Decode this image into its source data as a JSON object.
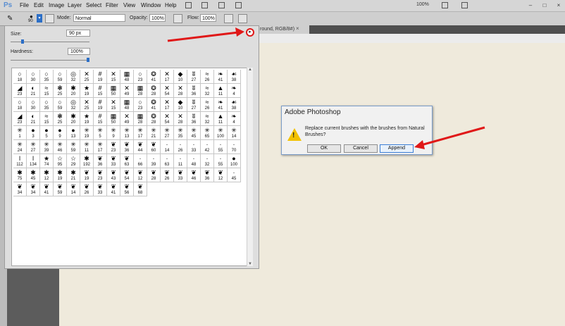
{
  "app": {
    "logo": "Ps",
    "menu": [
      "File",
      "Edit",
      "Image",
      "Layer",
      "Select",
      "Filter",
      "View",
      "Window",
      "Help"
    ],
    "zoom_display": "100%",
    "window_controls": [
      "–",
      "□",
      "×"
    ]
  },
  "options_bar": {
    "brush_size": "90",
    "mode_label": "Mode:",
    "mode_value": "Normal",
    "opacity_label": "Opacity:",
    "opacity_value": "100%",
    "flow_label": "Flow:",
    "flow_value": "100%"
  },
  "document_tab": {
    "title": "round, RGB/8#)",
    "close": "×"
  },
  "brush_panel": {
    "size_label": "Size:",
    "size_value": "90 px",
    "size_fraction": 0.15,
    "hardness_label": "Hardness:",
    "hardness_value": "100%",
    "hardness_fraction": 1.0,
    "menu_icon": "panel-flyout-menu-icon",
    "presets": [
      {
        "g": "○",
        "s": "18"
      },
      {
        "g": "○",
        "s": "30"
      },
      {
        "g": "○",
        "s": "35"
      },
      {
        "g": "○",
        "s": "59"
      },
      {
        "g": "◎",
        "s": "32"
      },
      {
        "g": "✕",
        "s": "25"
      },
      {
        "g": "#",
        "s": "19"
      },
      {
        "g": "✕",
        "s": "15"
      },
      {
        "g": "▦",
        "s": "48"
      },
      {
        "g": "○",
        "s": "23"
      },
      {
        "g": "❂",
        "s": "41"
      },
      {
        "g": "✕",
        "s": "17"
      },
      {
        "g": "◆",
        "s": "10"
      },
      {
        "g": "ʬ",
        "s": "27"
      },
      {
        "g": "≈",
        "s": "26"
      },
      {
        "g": "❧",
        "s": "41"
      },
      {
        "g": "☙",
        "s": "38"
      },
      {
        "g": "◢",
        "s": "23"
      },
      {
        "g": "◐",
        "s": "21"
      },
      {
        "g": "≈",
        "s": "15"
      },
      {
        "g": "❃",
        "s": "25"
      },
      {
        "g": "✱",
        "s": "20"
      },
      {
        "g": "★",
        "s": "19"
      },
      {
        "g": "#",
        "s": "15"
      },
      {
        "g": "▦",
        "s": "50"
      },
      {
        "g": "✕",
        "s": "49"
      },
      {
        "g": "▦",
        "s": "28"
      },
      {
        "g": "❂",
        "s": "28"
      },
      {
        "g": "✕",
        "s": "54"
      },
      {
        "g": "✕",
        "s": "28"
      },
      {
        "g": "ʬ",
        "s": "36"
      },
      {
        "g": "≈",
        "s": "32"
      },
      {
        "g": "▲",
        "s": "11"
      },
      {
        "g": "❧",
        "s": "4"
      },
      {
        "g": "○",
        "s": "18"
      },
      {
        "g": "○",
        "s": "30"
      },
      {
        "g": "○",
        "s": "35"
      },
      {
        "g": "○",
        "s": "59"
      },
      {
        "g": "◎",
        "s": "32"
      },
      {
        "g": "✕",
        "s": "25"
      },
      {
        "g": "#",
        "s": "19"
      },
      {
        "g": "✕",
        "s": "15"
      },
      {
        "g": "▦",
        "s": "48"
      },
      {
        "g": "○",
        "s": "23"
      },
      {
        "g": "❂",
        "s": "41"
      },
      {
        "g": "✕",
        "s": "17"
      },
      {
        "g": "◆",
        "s": "10"
      },
      {
        "g": "ʬ",
        "s": "27"
      },
      {
        "g": "≈",
        "s": "26"
      },
      {
        "g": "❧",
        "s": "41"
      },
      {
        "g": "☙",
        "s": "38"
      },
      {
        "g": "◢",
        "s": "23"
      },
      {
        "g": "◐",
        "s": "21"
      },
      {
        "g": "≈",
        "s": "15"
      },
      {
        "g": "❃",
        "s": "25"
      },
      {
        "g": "✱",
        "s": "20"
      },
      {
        "g": "★",
        "s": "19"
      },
      {
        "g": "#",
        "s": "15"
      },
      {
        "g": "▦",
        "s": "50"
      },
      {
        "g": "✕",
        "s": "49"
      },
      {
        "g": "▦",
        "s": "28"
      },
      {
        "g": "❂",
        "s": "28"
      },
      {
        "g": "✕",
        "s": "54"
      },
      {
        "g": "✕",
        "s": "28"
      },
      {
        "g": "ʬ",
        "s": "36"
      },
      {
        "g": "≈",
        "s": "32"
      },
      {
        "g": "▲",
        "s": "11"
      },
      {
        "g": "❧",
        "s": "4"
      },
      {
        "g": "✳",
        "s": "1"
      },
      {
        "g": "●",
        "s": "3"
      },
      {
        "g": "●",
        "s": "5"
      },
      {
        "g": "●",
        "s": "9"
      },
      {
        "g": "●",
        "s": "13"
      },
      {
        "g": "✳",
        "s": "19"
      },
      {
        "g": "✳",
        "s": "5"
      },
      {
        "g": "✳",
        "s": "9"
      },
      {
        "g": "✳",
        "s": "13"
      },
      {
        "g": "✳",
        "s": "17"
      },
      {
        "g": "✳",
        "s": "21"
      },
      {
        "g": "✳",
        "s": "27"
      },
      {
        "g": "✳",
        "s": "35"
      },
      {
        "g": "✳",
        "s": "45"
      },
      {
        "g": "✳",
        "s": "65"
      },
      {
        "g": "✳",
        "s": "100"
      },
      {
        "g": "✳",
        "s": "14"
      },
      {
        "g": "✳",
        "s": "24"
      },
      {
        "g": "✳",
        "s": "27"
      },
      {
        "g": "✳",
        "s": "39"
      },
      {
        "g": "✳",
        "s": "46"
      },
      {
        "g": "✳",
        "s": "59"
      },
      {
        "g": "✳",
        "s": "11"
      },
      {
        "g": "✳",
        "s": "17"
      },
      {
        "g": "❦",
        "s": "23"
      },
      {
        "g": "❦",
        "s": "36"
      },
      {
        "g": "❦",
        "s": "44"
      },
      {
        "g": "❦",
        "s": "60"
      },
      {
        "g": "·",
        "s": "14"
      },
      {
        "g": "·",
        "s": "26"
      },
      {
        "g": "·",
        "s": "33"
      },
      {
        "g": "·",
        "s": "42"
      },
      {
        "g": "·",
        "s": "55"
      },
      {
        "g": "·",
        "s": "70"
      },
      {
        "g": "ǀ",
        "s": "112"
      },
      {
        "g": "ǀ",
        "s": "134"
      },
      {
        "g": "★",
        "s": "74"
      },
      {
        "g": "☆",
        "s": "95"
      },
      {
        "g": "☆",
        "s": "29"
      },
      {
        "g": "✱",
        "s": "192"
      },
      {
        "g": "❦",
        "s": "36"
      },
      {
        "g": "❦",
        "s": "33"
      },
      {
        "g": "❦",
        "s": "63"
      },
      {
        "g": "·",
        "s": "66"
      },
      {
        "g": "·",
        "s": "39"
      },
      {
        "g": "·",
        "s": "63"
      },
      {
        "g": "·",
        "s": "11"
      },
      {
        "g": "·",
        "s": "48"
      },
      {
        "g": "·",
        "s": "32"
      },
      {
        "g": "·",
        "s": "55"
      },
      {
        "g": "●",
        "s": "100"
      },
      {
        "g": "✱",
        "s": "75"
      },
      {
        "g": "✱",
        "s": "45"
      },
      {
        "g": "✱",
        "s": "12"
      },
      {
        "g": "✱",
        "s": "19"
      },
      {
        "g": "✱",
        "s": "21"
      },
      {
        "g": "❦",
        "s": "19"
      },
      {
        "g": "❦",
        "s": "23"
      },
      {
        "g": "❦",
        "s": "43"
      },
      {
        "g": "❦",
        "s": "54"
      },
      {
        "g": "❦",
        "s": "12"
      },
      {
        "g": "❦",
        "s": "28"
      },
      {
        "g": "❦",
        "s": "26"
      },
      {
        "g": "❦",
        "s": "33"
      },
      {
        "g": "❦",
        "s": "46"
      },
      {
        "g": "❦",
        "s": "36"
      },
      {
        "g": "❦",
        "s": "12"
      },
      {
        "g": "·",
        "s": "45"
      },
      {
        "g": "❦",
        "s": "34"
      },
      {
        "g": "❦",
        "s": "34"
      },
      {
        "g": "❦",
        "s": "41"
      },
      {
        "g": "❦",
        "s": "59"
      },
      {
        "g": "❦",
        "s": "14"
      },
      {
        "g": "❦",
        "s": "26"
      },
      {
        "g": "❦",
        "s": "33"
      },
      {
        "g": "❦",
        "s": "41"
      },
      {
        "g": "❦",
        "s": "56"
      },
      {
        "g": "❦",
        "s": "68"
      }
    ]
  },
  "dialog": {
    "title": "Adobe Photoshop",
    "message": "Replace current brushes with the brushes from Natural Brushes?",
    "icon": "warning-icon",
    "buttons": {
      "ok": "OK",
      "cancel": "Cancel",
      "append": "Append"
    }
  },
  "colors": {
    "annotation_arrow": "#e01818",
    "accent": "#2c6fc7",
    "canvas": "#efeadc"
  }
}
